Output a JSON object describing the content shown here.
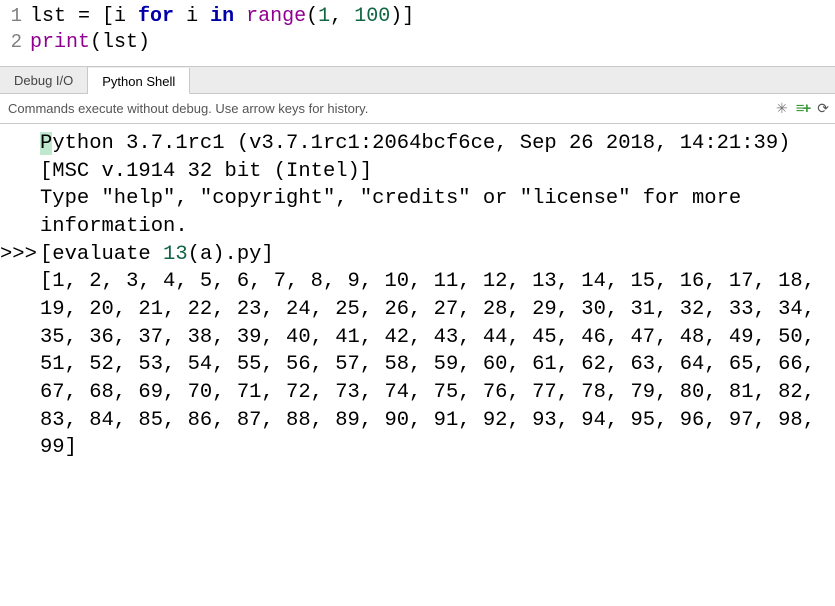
{
  "editor": {
    "lines": [
      {
        "number": "1"
      },
      {
        "number": "2"
      }
    ],
    "line1": {
      "var": "lst",
      "eq": " = [",
      "var2": "i ",
      "kw_for": "for",
      "sp1": " ",
      "var3": "i ",
      "kw_in": "in",
      "sp2": " ",
      "builtin": "range",
      "open": "(",
      "num1": "1",
      "comma": ", ",
      "num2": "100",
      "close": ")]"
    },
    "line2": {
      "func": "print",
      "open": "(",
      "var": "lst",
      "close": ")"
    }
  },
  "tabs": {
    "debug": "Debug I/O",
    "shell": "Python Shell"
  },
  "infobar": {
    "hint": "Commands execute without debug.  Use arrow keys for history."
  },
  "shell": {
    "banner": "ython 3.7.1rc1 (v3.7.1rc1:2064bcf6ce, Sep 26 2018, 14:21:39) [MSC v.1914 32 bit (Intel)]",
    "banner_first": "P",
    "help": "Type \"help\", \"copyright\", \"credits\" or \"license\" for more information.",
    "prompt": ">>> ",
    "eval_open": "[evaluate ",
    "eval_num": "13",
    "eval_rest": "(a).py]",
    "output": "[1, 2, 3, 4, 5, 6, 7, 8, 9, 10, 11, 12, 13, 14, 15, 16, 17, 18, 19, 20, 21, 22, 23, 24, 25, 26, 27, 28, 29, 30, 31, 32, 33, 34, 35, 36, 37, 38, 39, 40, 41, 42, 43, 44, 45, 46, 47, 48, 49, 50, 51, 52, 53, 54, 55, 56, 57, 58, 59, 60, 61, 62, 63, 64, 65, 66, 67, 68, 69, 70, 71, 72, 73, 74, 75, 76, 77, 78, 79, 80, 81, 82, 83, 84, 85, 86, 87, 88, 89, 90, 91, 92, 93, 94, 95, 96, 97, 98, 99]"
  },
  "chart_data": {
    "type": "table",
    "title": "Python list output",
    "values": [
      1,
      2,
      3,
      4,
      5,
      6,
      7,
      8,
      9,
      10,
      11,
      12,
      13,
      14,
      15,
      16,
      17,
      18,
      19,
      20,
      21,
      22,
      23,
      24,
      25,
      26,
      27,
      28,
      29,
      30,
      31,
      32,
      33,
      34,
      35,
      36,
      37,
      38,
      39,
      40,
      41,
      42,
      43,
      44,
      45,
      46,
      47,
      48,
      49,
      50,
      51,
      52,
      53,
      54,
      55,
      56,
      57,
      58,
      59,
      60,
      61,
      62,
      63,
      64,
      65,
      66,
      67,
      68,
      69,
      70,
      71,
      72,
      73,
      74,
      75,
      76,
      77,
      78,
      79,
      80,
      81,
      82,
      83,
      84,
      85,
      86,
      87,
      88,
      89,
      90,
      91,
      92,
      93,
      94,
      95,
      96,
      97,
      98,
      99
    ]
  }
}
